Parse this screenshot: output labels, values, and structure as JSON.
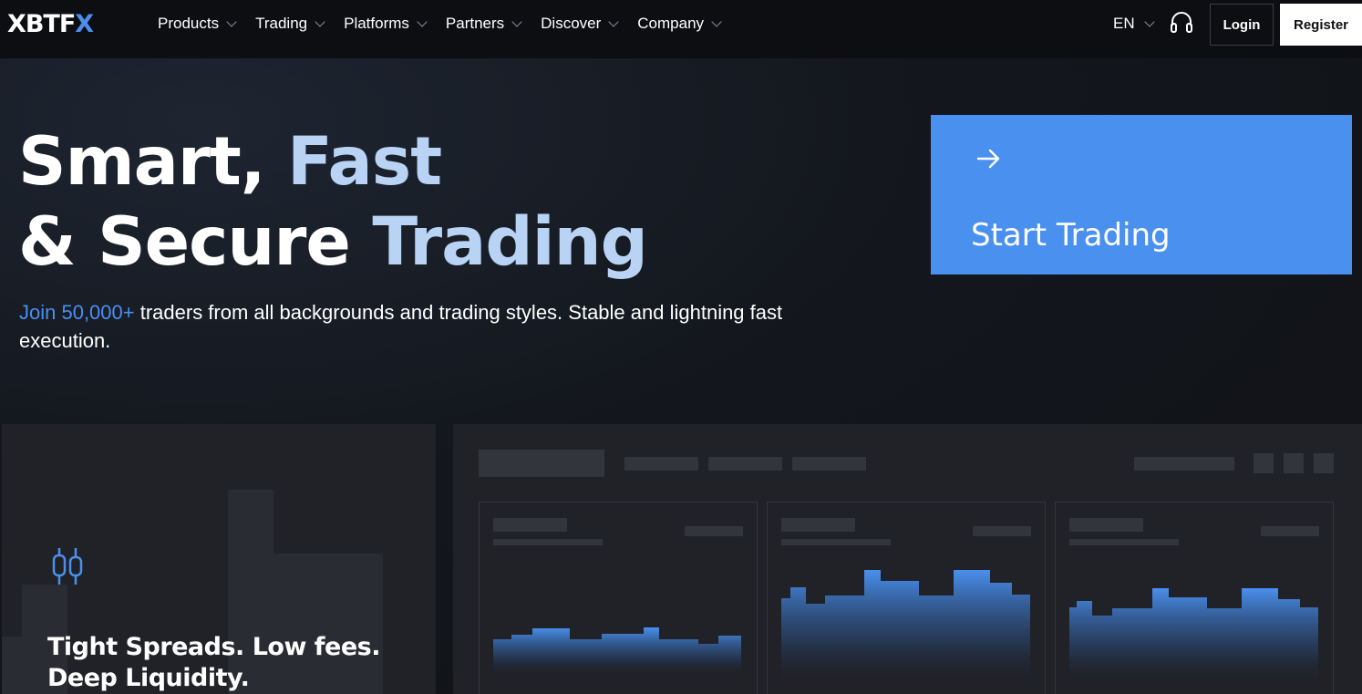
{
  "brand": {
    "logo_text_main": "XBTF",
    "logo_text_accent": "X"
  },
  "nav": {
    "items": [
      {
        "label": "Products"
      },
      {
        "label": "Trading"
      },
      {
        "label": "Platforms"
      },
      {
        "label": "Partners"
      },
      {
        "label": "Discover"
      },
      {
        "label": "Company"
      }
    ],
    "language": "EN",
    "login_label": "Login",
    "register_label": "Register"
  },
  "hero": {
    "line1_white": "Smart, ",
    "line1_blue": "Fast",
    "line2_white": "& Secure ",
    "line2_blue": "Trading",
    "sub_accent": "Join 50,000+",
    "sub_rest": " traders from all backgrounds and trading styles. Stable and lightning fast execution.",
    "cta_label": "Start Trading"
  },
  "features": {
    "card_title_line1": "Tight Spreads. Low fees.",
    "card_title_line2": "Deep Liquidity."
  },
  "colors": {
    "accent": "#4a90ee",
    "headline_blue": "#b9d3f5",
    "background": "#121419",
    "card": "#202228"
  },
  "icons": [
    "chevron-down-icon",
    "headset-icon",
    "arrow-right-icon",
    "candlestick-icon"
  ]
}
